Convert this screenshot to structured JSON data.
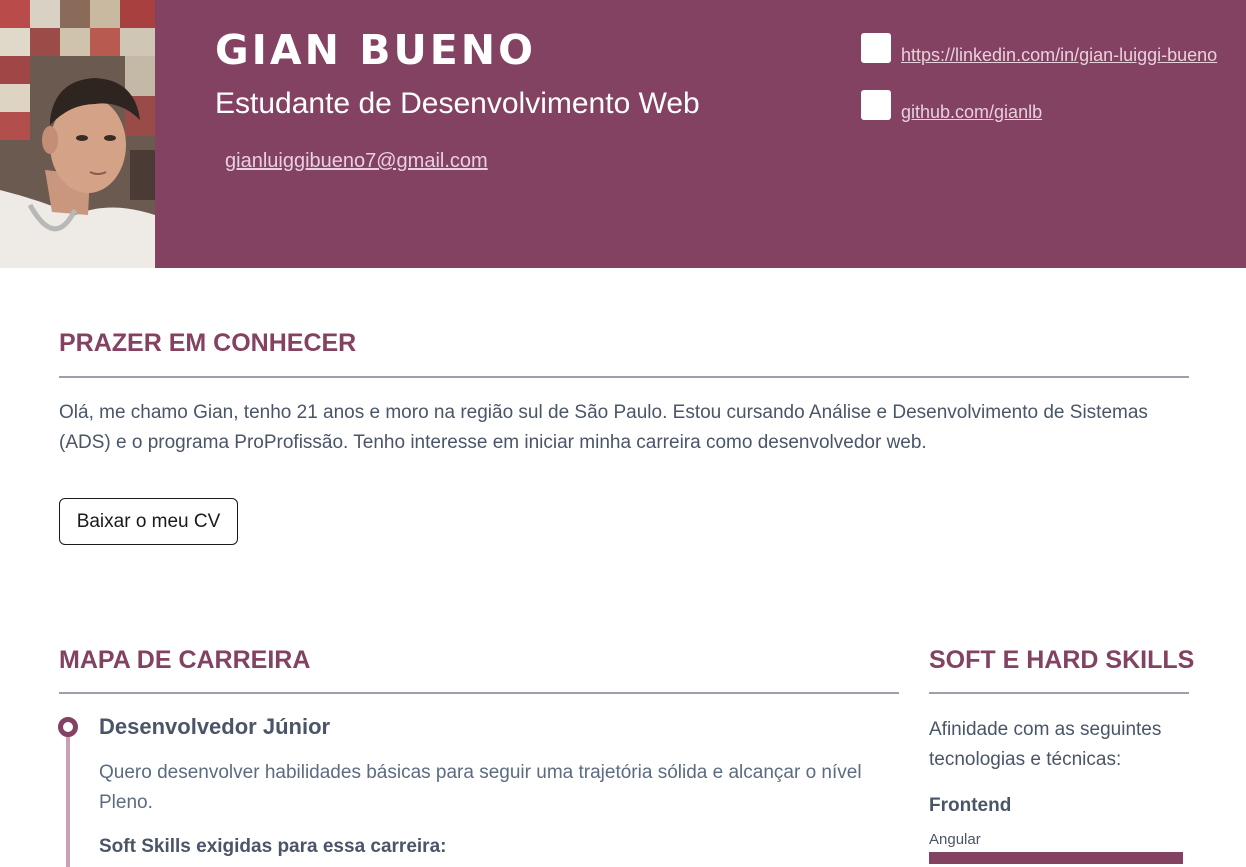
{
  "header": {
    "name": "GIAN BUENO",
    "subtitle": "Estudante de Desenvolvimento Web",
    "email": "gianluiggibueno7@gmail.com",
    "links": {
      "linkedin": "https://linkedin.com/in/gian-luiggi-bueno",
      "github": "github.com/gianlb"
    },
    "accent_color": "#834262"
  },
  "intro": {
    "title": "PRAZER EM CONHECER",
    "text": "Olá, me chamo Gian, tenho 21 anos e moro na região sul de São Paulo. Estou cursando Análise e Desenvolvimento de Sistemas (ADS) e o programa ProProfissão. Tenho interesse em iniciar minha carreira como desenvolvedor web.",
    "cv_button": "Baixar o meu CV"
  },
  "career": {
    "title": "MAPA DE CARREIRA",
    "items": [
      {
        "title": "Desenvolvedor Júnior",
        "description": "Quero desenvolver habilidades básicas para seguir uma trajetória sólida e alcançar o nível Pleno.",
        "soft_skills_label": "Soft Skills exigidas para essa carreira:"
      }
    ]
  },
  "skills": {
    "title": "SOFT E HARD SKILLS",
    "intro": "Afinidade com as seguintes tecnologias e técnicas:",
    "groups": [
      {
        "name": "Frontend",
        "items": [
          {
            "name": "Angular",
            "level": 1.0
          }
        ]
      }
    ]
  }
}
